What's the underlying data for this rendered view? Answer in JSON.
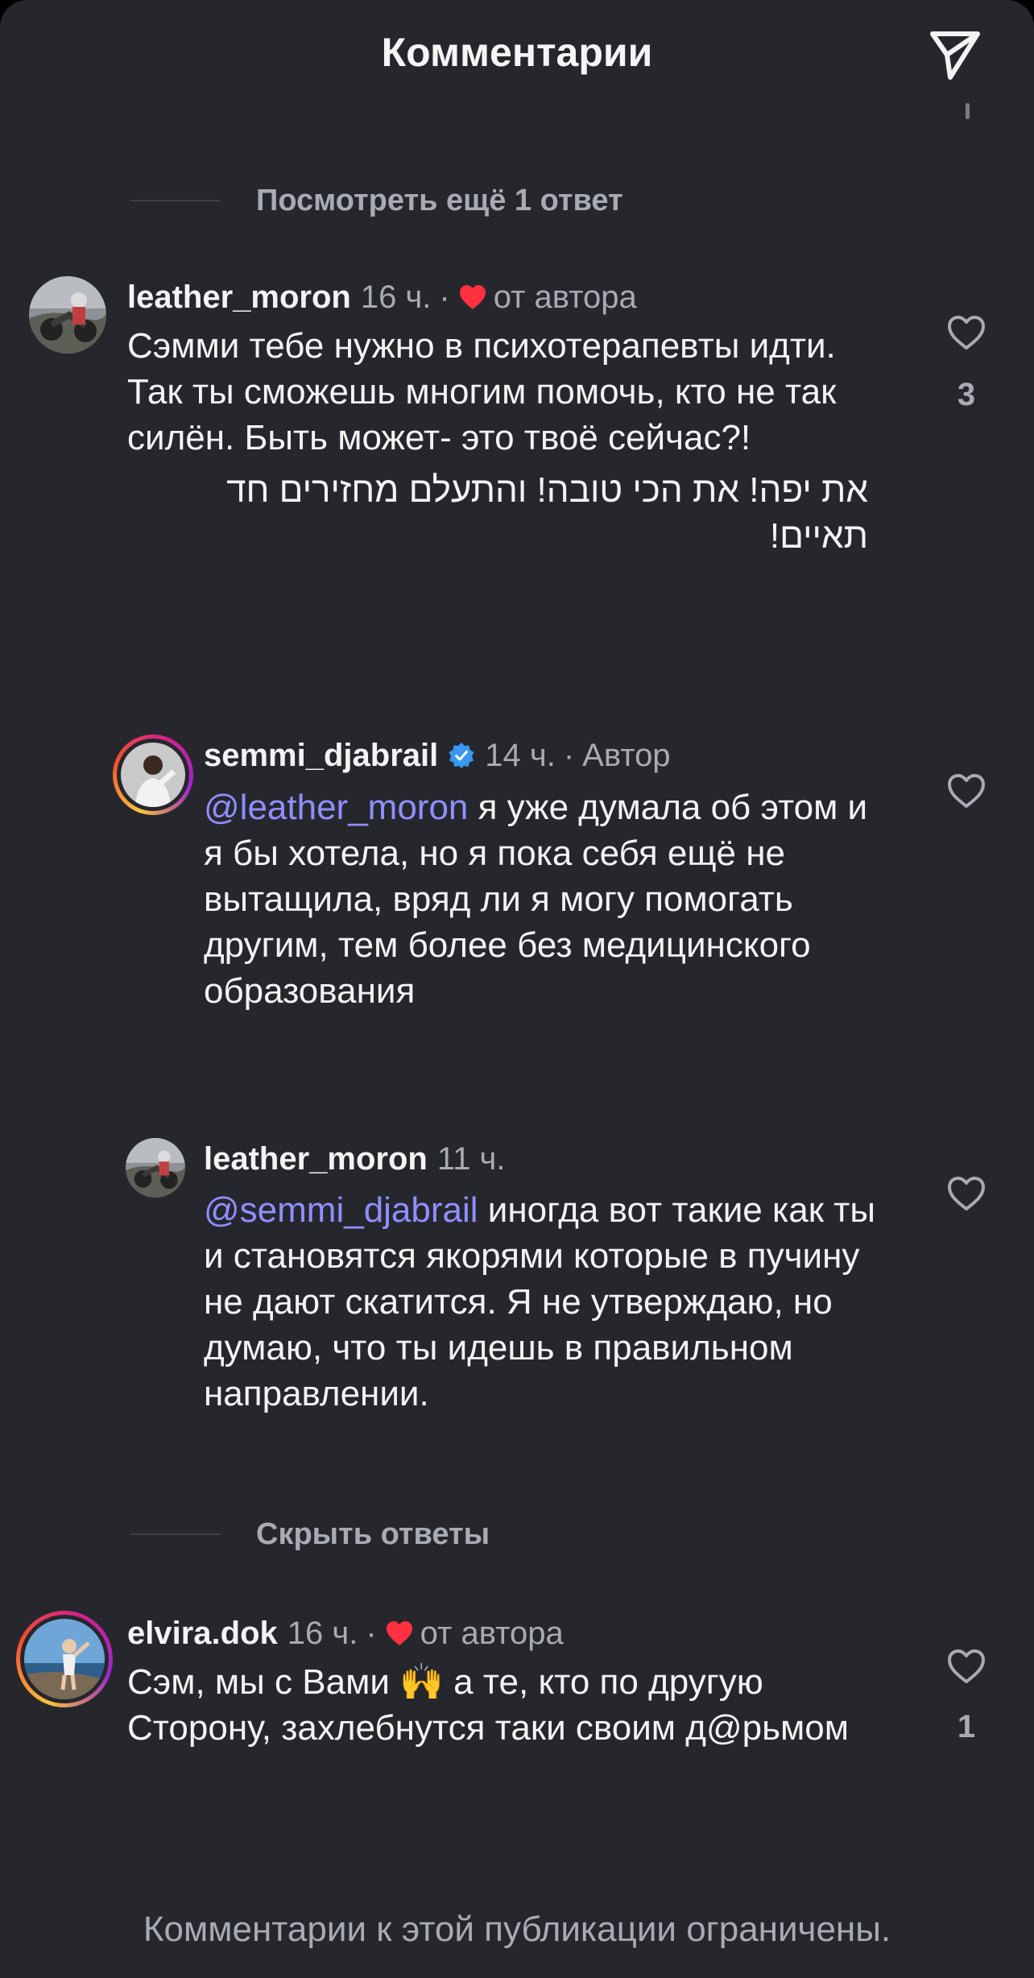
{
  "header": {
    "title": "Комментарии",
    "share_icon": "paper-plane-icon"
  },
  "toggles": {
    "view_more": "Посмотреть ещё 1 ответ",
    "hide_replies": "Скрыть ответы"
  },
  "comments": [
    {
      "username": "leather_moron",
      "time": "16 ч.",
      "author_liked": true,
      "author_liked_label": "от автора",
      "text": "Сэмми тебе нужно в психотерапевты идти. Так ты сможешь многим помочь, кто не так силён. Быть может- это твоё сейчас?!",
      "text_rtl": "את יפה! את הכי טובה! והתעלם מחזירים חד תאיים!",
      "likes": "3"
    },
    {
      "username": "semmi_djabrail",
      "verified": true,
      "time": "14 ч.",
      "role": "Автор",
      "mention": "@leather_moron",
      "text": "я уже думала об этом и я бы хотела, но я пока себя ещё не вытащила, вряд ли я могу помогать другим, тем более без медицинского образования"
    },
    {
      "username": "leather_moron",
      "time": "11 ч.",
      "mention": "@semmi_djabrail",
      "text": "иногда вот такие как ты и становятся якорями которые в пучину не дают скатится. Я не утверждаю, но думаю, что ты идешь в правильном направлении."
    },
    {
      "username": "elvira.dok",
      "time": "16 ч.",
      "author_liked": true,
      "author_liked_label": "от автора",
      "text_before_emoji": "Сэм, мы с Вами",
      "emoji": "🙌",
      "text_after_emoji": "а те, кто по другую Сторону, захлебнутся таки своим д@рьмом",
      "likes": "1"
    }
  ],
  "separators": {
    "dot": "·"
  },
  "footer": {
    "note": "Комментарии к этой публикации ограничены."
  },
  "colors": {
    "background": "#25272d",
    "text_primary": "#f3f3f3",
    "text_secondary": "#a8abb2",
    "mention": "#8f8fff",
    "heart_red": "#ff3040",
    "verified_blue": "#3897f0"
  }
}
